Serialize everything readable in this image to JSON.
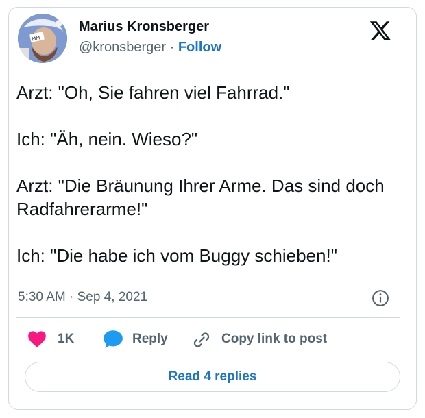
{
  "author": {
    "name": "Marius Kronsberger",
    "handle": "@kronsberger",
    "separator": "·",
    "follow_label": "Follow"
  },
  "tweet": {
    "lines": [
      "Arzt: \"Oh, Sie fahren viel Fahrrad.\"",
      "Ich: \"Äh, nein. Wieso?\"",
      "Arzt: \"Die Bräunung Ihrer Arme. Das sind doch Radfahrerarme!\"",
      "Ich: \"Die habe ich vom Buggy schieben!\""
    ],
    "time": "5:30 AM",
    "date_separator": "·",
    "date": "Sep 4, 2021"
  },
  "actions": {
    "likes": "1K",
    "reply_label": "Reply",
    "copy_label": "Copy link to post"
  },
  "footer": {
    "read_replies_label": "Read 4 replies"
  },
  "colors": {
    "like": "#f91880",
    "reply": "#1d9bf0",
    "link_text": "#1d74c8",
    "secondary_text": "#536471"
  }
}
